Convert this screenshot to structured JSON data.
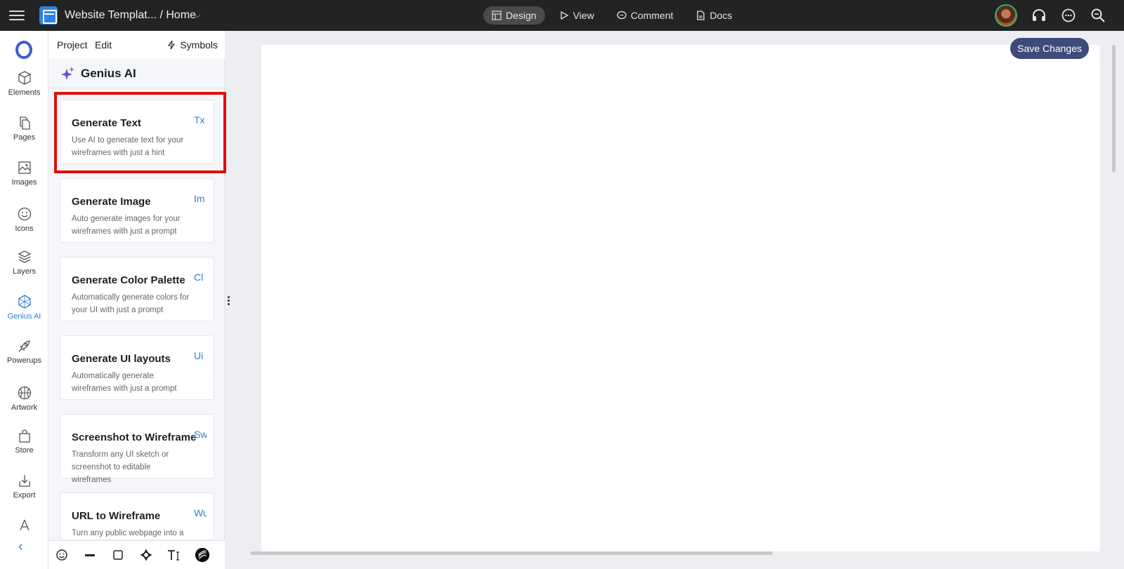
{
  "topbar": {
    "title": "Website Templat... / Home",
    "modes": [
      {
        "label": "Design",
        "active": true
      },
      {
        "label": "View",
        "active": false
      },
      {
        "label": "Comment",
        "active": false
      },
      {
        "label": "Docs",
        "active": false
      }
    ]
  },
  "leftnav": {
    "items": [
      {
        "label": "Elements",
        "icon": "cube-icon"
      },
      {
        "label": "Pages",
        "icon": "pages-icon"
      },
      {
        "label": "Images",
        "icon": "image-icon"
      },
      {
        "label": "Icons",
        "icon": "smiley-icon"
      },
      {
        "label": "Layers",
        "icon": "layers-icon"
      },
      {
        "label": "Genius AI",
        "icon": "genius-icon",
        "active": true
      },
      {
        "label": "Powerups",
        "icon": "rocket-icon"
      },
      {
        "label": "Artwork",
        "icon": "basketball-icon"
      },
      {
        "label": "Store",
        "icon": "bag-icon"
      },
      {
        "label": "Export",
        "icon": "download-icon"
      }
    ]
  },
  "panel": {
    "project": "Project",
    "edit": "Edit",
    "symbols": "Symbols",
    "heading": "Genius AI",
    "cards": [
      {
        "title": "Generate Text",
        "desc": "Use AI to generate text for your wireframes with just a hint",
        "badge": "Tx"
      },
      {
        "title": "Generate Image",
        "desc": "Auto generate images for your wireframes with just a prompt",
        "badge": "Im"
      },
      {
        "title": "Generate Color Palette",
        "desc": "Automatically generate colors for your UI with just a prompt",
        "badge": "Cl"
      },
      {
        "title": "Generate UI layouts",
        "desc": "Automatically generate wireframes with just a prompt",
        "badge": "Ui"
      },
      {
        "title": "Screenshot to Wireframe",
        "desc": "Transform any UI sketch or screenshot to editable wireframes",
        "badge": "Sw"
      },
      {
        "title": "URL to Wireframe",
        "desc": "Turn any public webpage into a",
        "badge": "Wu"
      }
    ]
  },
  "canvas": {
    "save_label": "Save Changes"
  },
  "colors": {
    "topbar": "#232323",
    "accent": "#2f7fd3",
    "save_button": "#3d4a7a",
    "highlight": "#e10e0e"
  }
}
